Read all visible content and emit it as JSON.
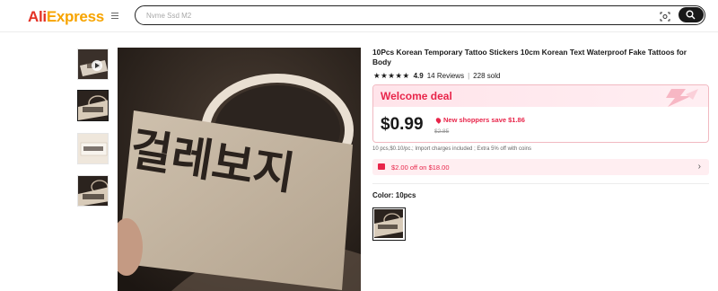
{
  "header": {
    "logo_part1": "Ali",
    "logo_part2": "Express",
    "search_placeholder": "Nvme Ssd M2",
    "icons": [
      "menu-icon",
      "camera-icon",
      "search-icon"
    ]
  },
  "gallery": {
    "thumbnails": [
      {
        "name": "thumbnail-video",
        "has_play": true
      },
      {
        "name": "thumbnail-1",
        "active": true
      },
      {
        "name": "thumbnail-2"
      },
      {
        "name": "thumbnail-3"
      }
    ],
    "main_image_text": "걸레보지"
  },
  "product": {
    "title": "10Pcs Korean Temporary Tattoo Stickers 10cm Korean Text Waterproof Fake Tattoos for Body",
    "rating": "4.9",
    "reviews": "14 Reviews",
    "sold": "228 sold"
  },
  "deal": {
    "label": "Welcome deal",
    "price": "$0.99",
    "savings": "New shoppers save $1.86",
    "old_price": "$2.85",
    "accent_color": "#e8254a"
  },
  "import_note": "10 pcs,$0.10/pc.; Import charges included ; Extra 5% off with coins",
  "coupon": {
    "text": "$2.00 off on $18.00"
  },
  "variant": {
    "label": "Color: 10pcs"
  }
}
